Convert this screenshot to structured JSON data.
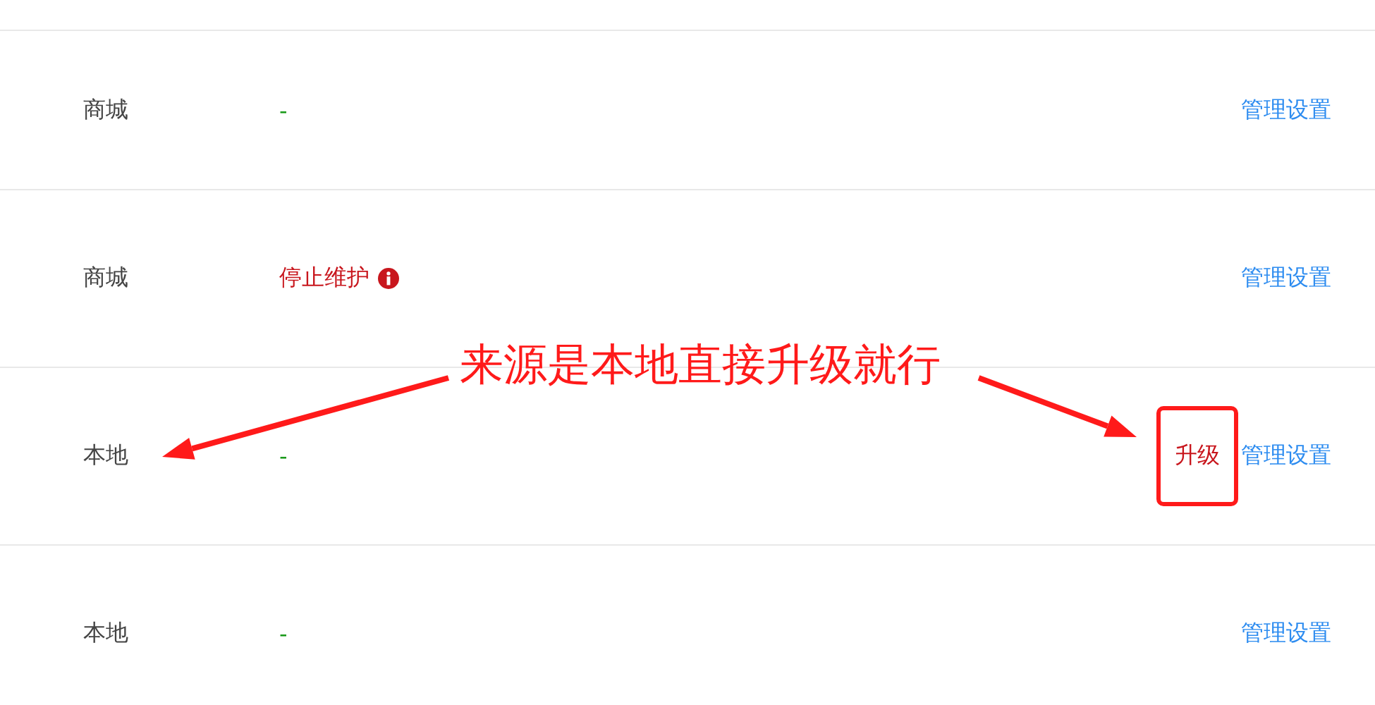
{
  "rows": [
    {
      "source": "商城",
      "status": {
        "kind": "normal",
        "text": "-"
      },
      "actions": [
        {
          "kind": "manage",
          "label": "管理设置",
          "highlighted": false
        }
      ]
    },
    {
      "source": "商城",
      "status": {
        "kind": "warning",
        "text": "停止维护"
      },
      "actions": [
        {
          "kind": "manage",
          "label": "管理设置",
          "highlighted": false
        }
      ]
    },
    {
      "source": "本地",
      "status": {
        "kind": "normal",
        "text": "-"
      },
      "actions": [
        {
          "kind": "upgrade",
          "label": "升级",
          "highlighted": true
        },
        {
          "kind": "manage",
          "label": "管理设置",
          "highlighted": false
        }
      ]
    },
    {
      "source": "本地",
      "status": {
        "kind": "normal",
        "text": "-"
      },
      "actions": [
        {
          "kind": "manage",
          "label": "管理设置",
          "highlighted": false
        }
      ]
    }
  ],
  "annotation": {
    "text": "来源是本地直接升级就行"
  }
}
